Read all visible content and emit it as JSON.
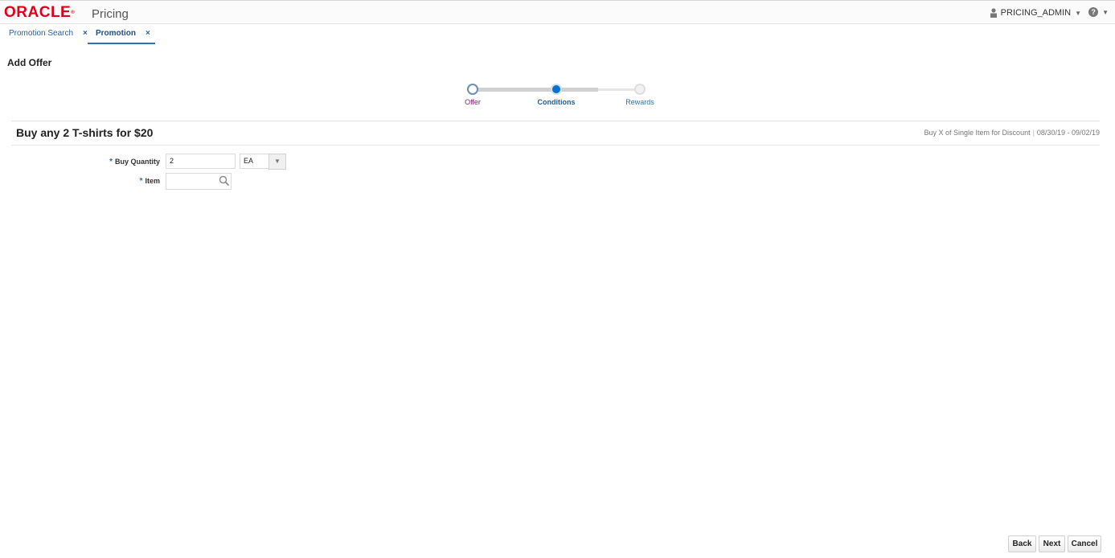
{
  "header": {
    "logo_text": "ORACLE",
    "product": "Pricing",
    "user": "PRICING_ADMIN",
    "help_glyph": "?",
    "brand_color": "#e0001b"
  },
  "tabs": [
    {
      "label": "Promotion Search",
      "close": "×",
      "active": false
    },
    {
      "label": "Promotion",
      "close": "×",
      "active": true
    }
  ],
  "page": {
    "title": "Add Offer"
  },
  "train": {
    "stops": [
      {
        "label": "Offer",
        "state": "visited"
      },
      {
        "label": "Conditions",
        "state": "current"
      },
      {
        "label": "Rewards",
        "state": "unvisited"
      }
    ]
  },
  "section": {
    "title": "Buy any 2 T-shirts for $20",
    "offer_type": "Buy X of Single Item for Discount",
    "separator": "|",
    "date_range": "08/30/19 - 09/02/19"
  },
  "form": {
    "required_mark": "*",
    "buy_quantity": {
      "label": "Buy Quantity",
      "value": "2",
      "uom": "EA"
    },
    "item": {
      "label": "Item",
      "value": ""
    }
  },
  "buttons": {
    "back": "Back",
    "next": "Next",
    "cancel": "Cancel"
  }
}
